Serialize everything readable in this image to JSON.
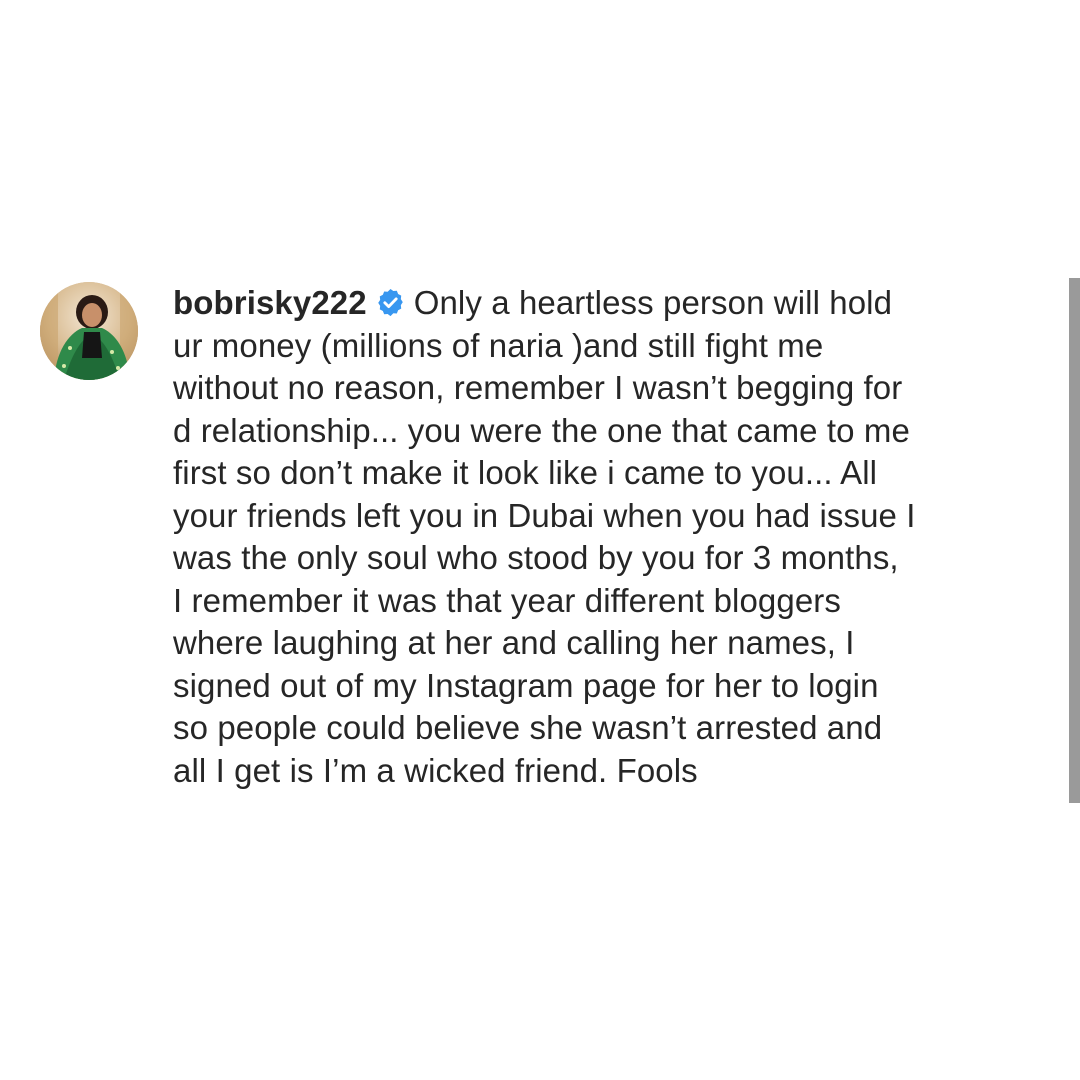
{
  "comment": {
    "username": "bobrisky222",
    "verified_badge_icon": "verified-badge-icon",
    "badge_color": "#3897f0",
    "lines": [
      "Only a heartless person will hold",
      "ur money (millions of naria )and still fight me",
      "without no reason, remember I wasn’t begging for",
      "d relationship... you were the one that came to me",
      "first so don’t make it look like i came to you... All",
      "your friends left you in Dubai when you had issue I",
      "was the only soul who stood by you for 3 months,",
      "I remember it was that year different bloggers",
      "where laughing at her and calling her names, I",
      "signed out of my Instagram page for her to login",
      "so people could believe she wasn’t arrested and",
      "all I get is I’m a wicked friend. Fools"
    ]
  },
  "colors": {
    "text": "#262626",
    "background": "#ffffff",
    "scrollbar": "#9a9a9a"
  }
}
